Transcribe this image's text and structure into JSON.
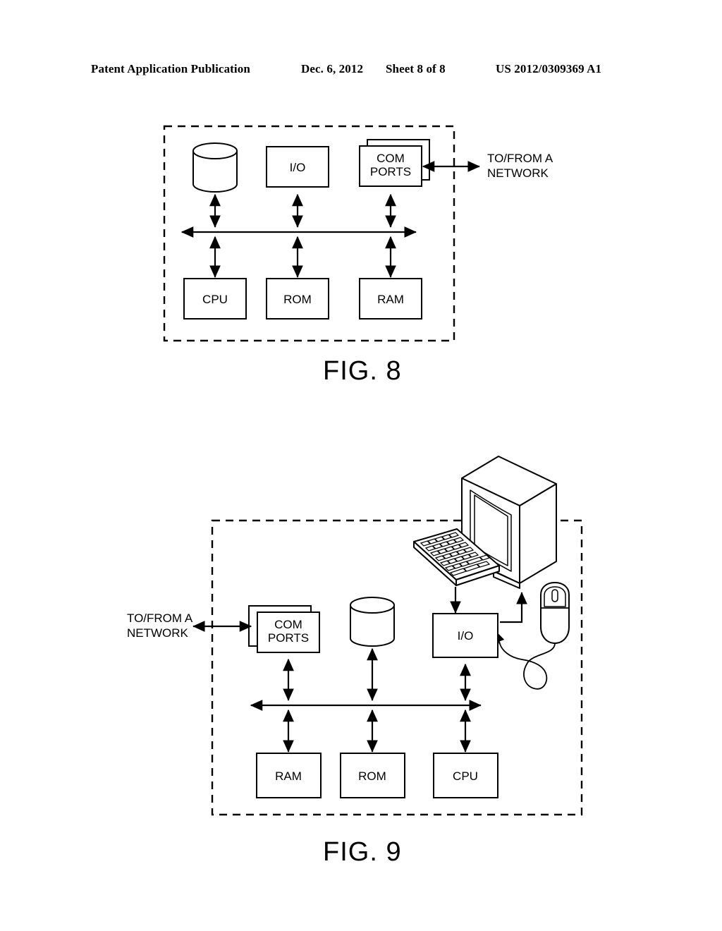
{
  "header": {
    "publication": "Patent Application Publication",
    "date": "Dec. 6, 2012",
    "sheet": "Sheet 8 of 8",
    "patent_number": "US 2012/0309369 A1"
  },
  "figures": [
    {
      "id": "fig8",
      "caption": "FIG. 8",
      "enclosure": "dashed-boundary",
      "network_label_line1": "TO/FROM A",
      "network_label_line2": "NETWORK",
      "top_row": [
        {
          "name": "disk-storage",
          "label": "",
          "shape": "cylinder"
        },
        {
          "name": "io",
          "label": "I/O",
          "shape": "rect"
        },
        {
          "name": "com-ports",
          "label_line1": "COM",
          "label_line2": "PORTS",
          "shape": "stacked-rect"
        }
      ],
      "bottom_row": [
        {
          "name": "cpu",
          "label": "CPU",
          "shape": "rect"
        },
        {
          "name": "rom",
          "label": "ROM",
          "shape": "rect"
        },
        {
          "name": "ram",
          "label": "RAM",
          "shape": "rect"
        }
      ],
      "bus": "bidirectional-bus"
    },
    {
      "id": "fig9",
      "caption": "FIG. 9",
      "enclosure": "dashed-boundary",
      "network_label_line1": "TO/FROM A",
      "network_label_line2": "NETWORK",
      "peripherals": [
        {
          "name": "monitor",
          "label": ""
        },
        {
          "name": "keyboard",
          "label": ""
        },
        {
          "name": "mouse",
          "label": ""
        }
      ],
      "top_row": [
        {
          "name": "com-ports",
          "label_line1": "COM",
          "label_line2": "PORTS",
          "shape": "stacked-rect"
        },
        {
          "name": "disk-storage",
          "label": "",
          "shape": "cylinder"
        },
        {
          "name": "io",
          "label": "I/O",
          "shape": "rect"
        }
      ],
      "bottom_row": [
        {
          "name": "ram",
          "label": "RAM",
          "shape": "rect"
        },
        {
          "name": "rom",
          "label": "ROM",
          "shape": "rect"
        },
        {
          "name": "cpu",
          "label": "CPU",
          "shape": "rect"
        }
      ],
      "bus": "bidirectional-bus"
    }
  ],
  "colors": {
    "ink": "#000000",
    "paper": "#ffffff"
  }
}
